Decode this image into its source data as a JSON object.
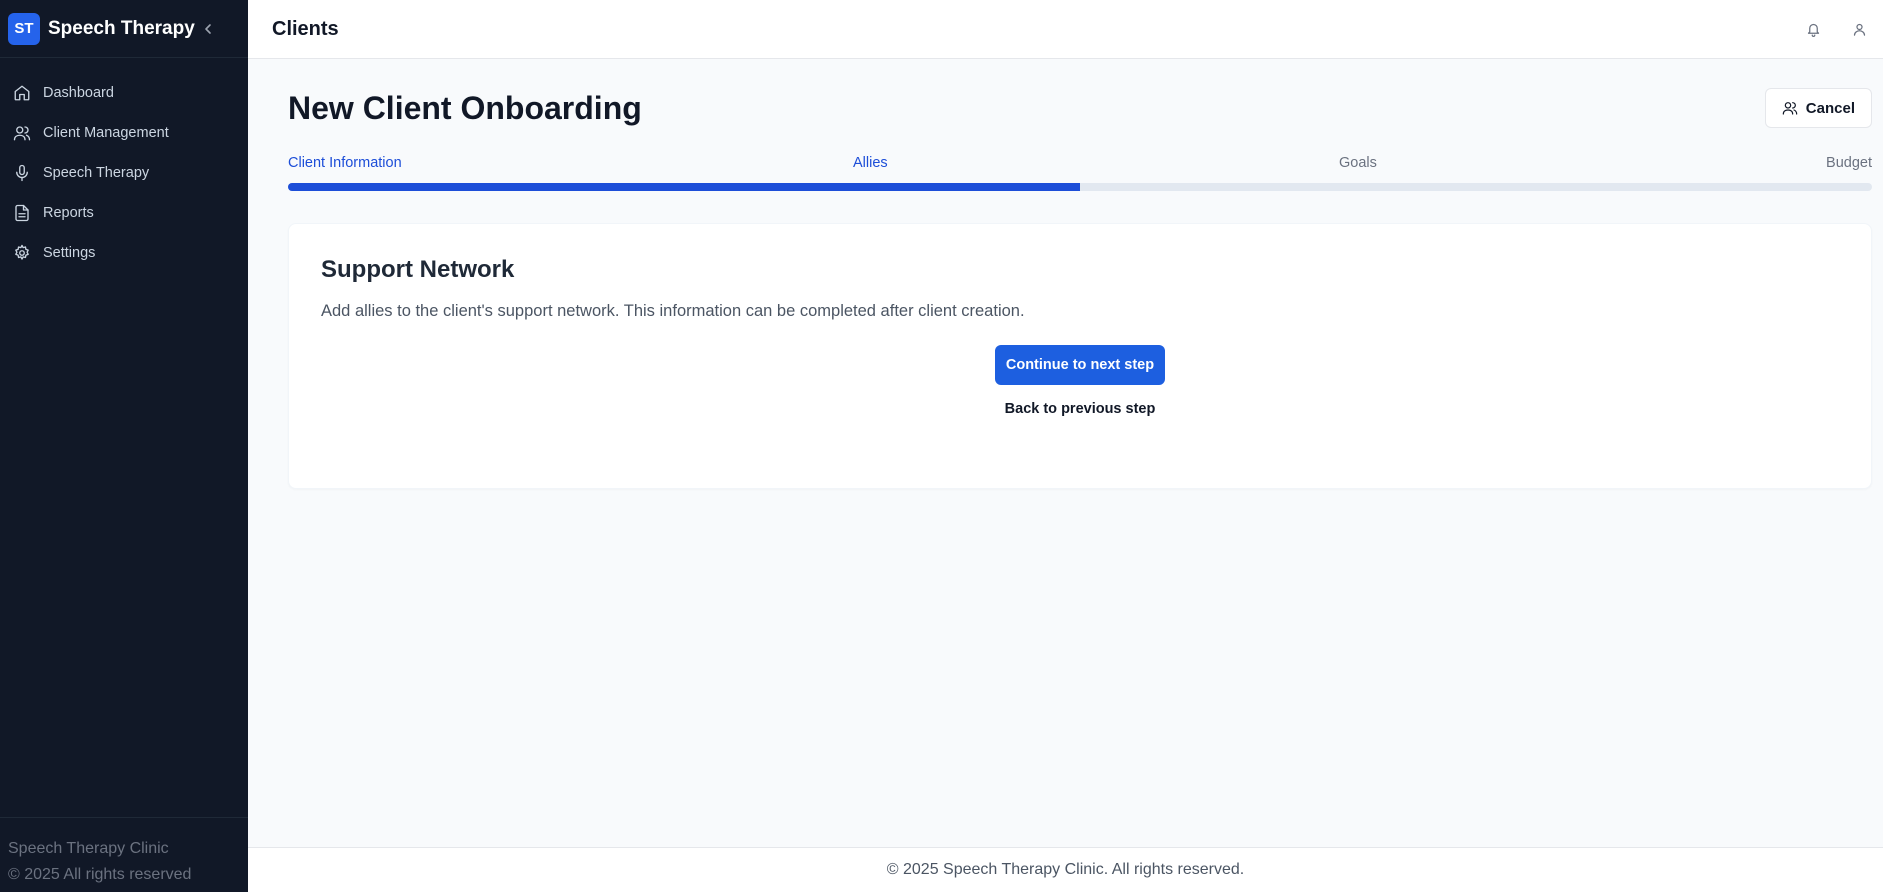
{
  "sidebar": {
    "logo_text": "ST",
    "app_title": "Speech Therapy",
    "items": [
      {
        "label": "Dashboard",
        "icon": "home-icon"
      },
      {
        "label": "Client Management",
        "icon": "users-icon"
      },
      {
        "label": "Speech Therapy",
        "icon": "mic-icon"
      },
      {
        "label": "Reports",
        "icon": "file-icon"
      },
      {
        "label": "Settings",
        "icon": "gear-icon"
      }
    ],
    "footer_line1": "Speech Therapy Clinic",
    "footer_line2": "© 2025 All rights reserved"
  },
  "topbar": {
    "title": "Clients",
    "icons": [
      "bell-icon",
      "user-icon"
    ]
  },
  "page": {
    "title": "New Client Onboarding",
    "cancel_label": "Cancel"
  },
  "steps": {
    "items": [
      {
        "label": "Client Information",
        "status": "complete"
      },
      {
        "label": "Allies",
        "status": "current"
      },
      {
        "label": "Goals",
        "status": "upcoming"
      },
      {
        "label": "Budget",
        "status": "upcoming"
      }
    ],
    "progress_fraction": 0.5
  },
  "card": {
    "title": "Support Network",
    "description": "Add allies to the client's support network. This information can be completed after client creation.",
    "continue_label": "Continue to next step",
    "back_label": "Back to previous step"
  },
  "footer": {
    "text": "© 2025 Speech Therapy Clinic. All rights reserved."
  },
  "colors": {
    "sidebar_bg": "#111827",
    "accent": "#1d4ed8",
    "logo_bg": "#2563eb"
  }
}
